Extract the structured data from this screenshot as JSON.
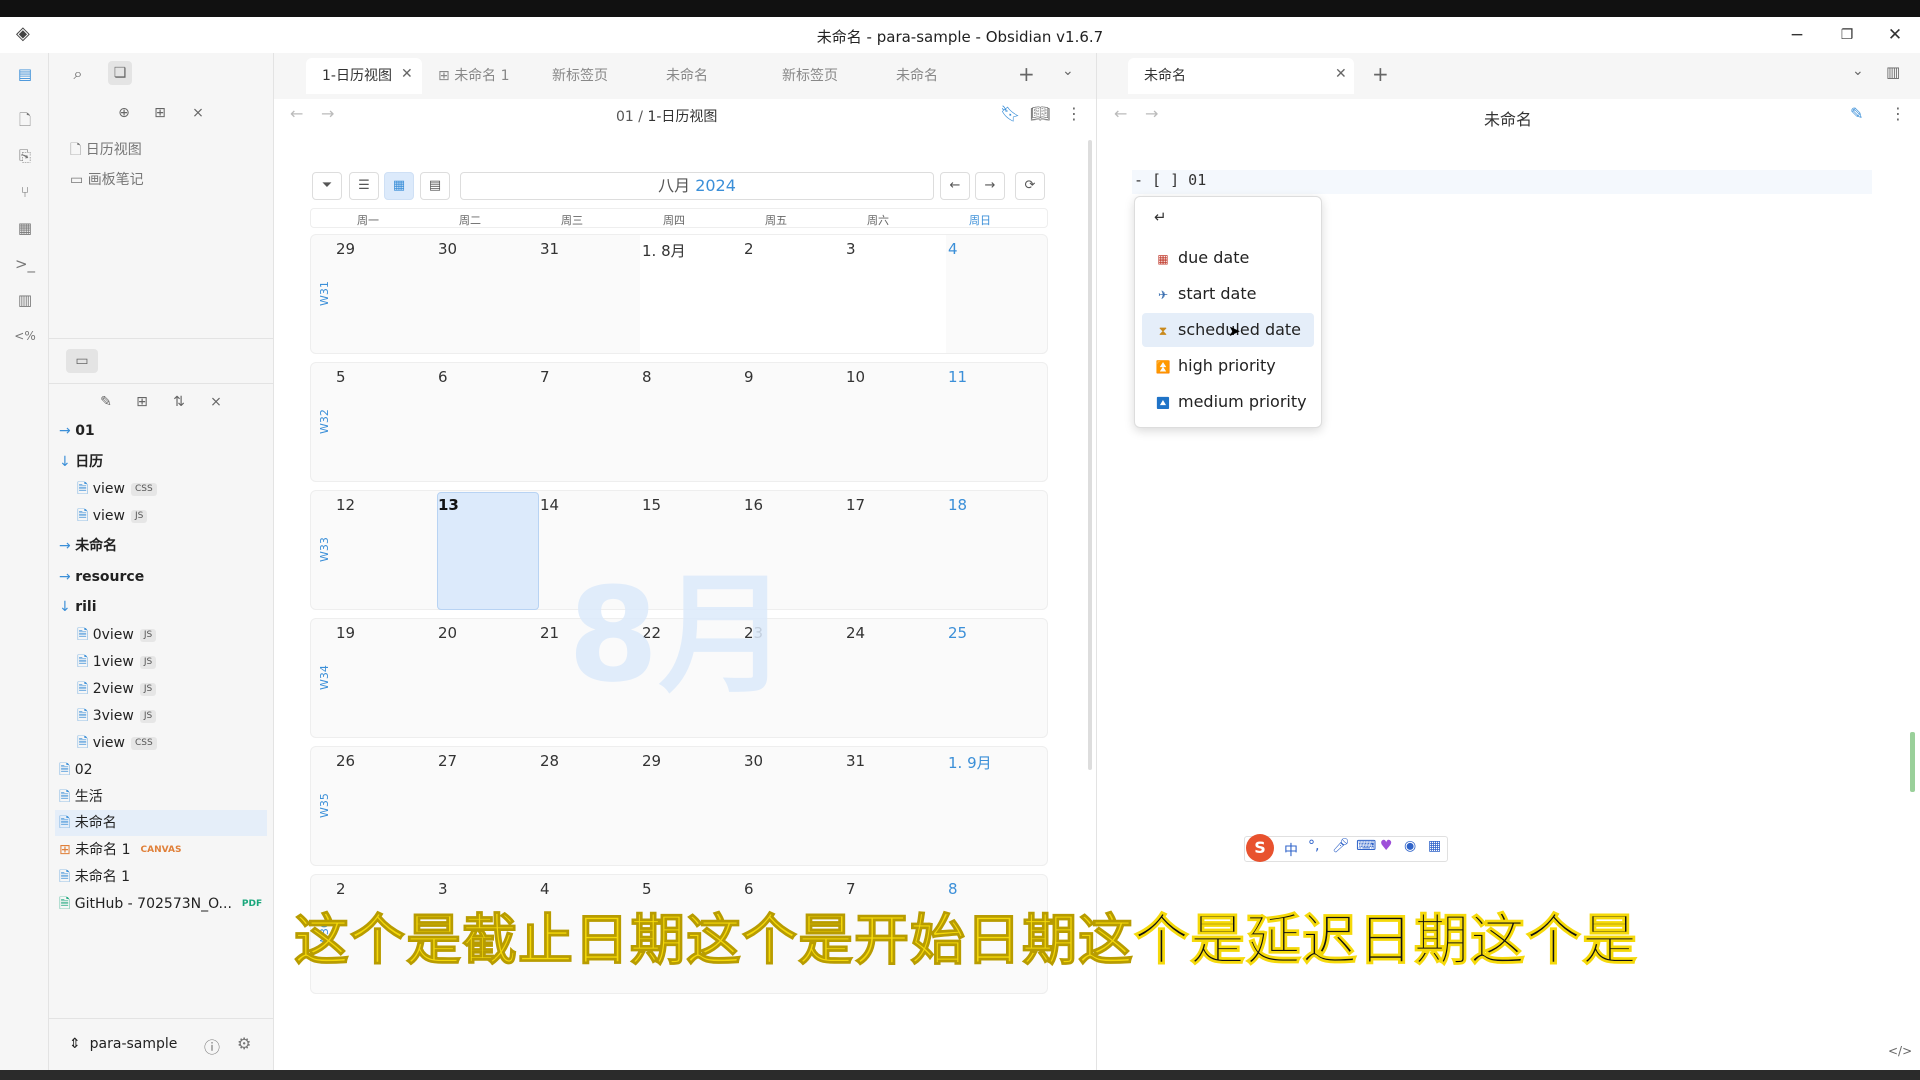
{
  "window": {
    "title": "未命名 - para-sample - Obsidian v1.6.7"
  },
  "left_tree": {
    "bookmarks": [
      "日历视图",
      "画板笔记"
    ],
    "items": [
      {
        "label": "01",
        "type": "folder-collapsed"
      },
      {
        "label": "日历",
        "type": "folder-open"
      },
      {
        "label": "view",
        "tag": "CSS",
        "indent": 1
      },
      {
        "label": "view",
        "tag": "JS",
        "indent": 1
      },
      {
        "label": "未命名",
        "type": "folder-collapsed"
      },
      {
        "label": "resource",
        "type": "folder-collapsed"
      },
      {
        "label": "rili",
        "type": "folder-open"
      },
      {
        "label": "0view",
        "tag": "JS",
        "indent": 1
      },
      {
        "label": "1view",
        "tag": "JS",
        "indent": 1
      },
      {
        "label": "2view",
        "tag": "JS",
        "indent": 1
      },
      {
        "label": "3view",
        "tag": "JS",
        "indent": 1
      },
      {
        "label": "view",
        "tag": "CSS",
        "indent": 1
      },
      {
        "label": "02",
        "type": "file"
      },
      {
        "label": "生活",
        "type": "file"
      },
      {
        "label": "未命名",
        "type": "file",
        "selected": true
      },
      {
        "label": "未命名 1",
        "tag": "CANVAS",
        "type": "canvas"
      },
      {
        "label": "未命名 1",
        "type": "file"
      },
      {
        "label": "GitHub - 702573N_O...",
        "tag": "PDF",
        "type": "pdf"
      }
    ],
    "vault": "para-sample"
  },
  "tabs_left": [
    "1-日历视图",
    "未命名 1",
    "新标签页",
    "未命名",
    "新标签页",
    "未命名"
  ],
  "tabs_right": [
    "未命名"
  ],
  "left_pane": {
    "breadcrumb_folder": "01",
    "breadcrumb_sep": "/",
    "breadcrumb_file": "1-日历视图"
  },
  "right_pane": {
    "title": "未命名",
    "task_line": "- [ ] 01"
  },
  "calendar": {
    "month_label": "八月",
    "year": "2024",
    "watermark": "8月",
    "weekdays": [
      "周一",
      "周二",
      "周三",
      "周四",
      "周五",
      "周六",
      "周日"
    ],
    "weeks": [
      {
        "label": "W31",
        "days": [
          "29",
          "30",
          "31",
          "1. 8月",
          "2",
          "3",
          "4"
        ]
      },
      {
        "label": "W32",
        "days": [
          "5",
          "6",
          "7",
          "8",
          "9",
          "10",
          "11"
        ]
      },
      {
        "label": "W33",
        "days": [
          "12",
          "13",
          "14",
          "15",
          "16",
          "17",
          "18"
        ]
      },
      {
        "label": "W34",
        "days": [
          "19",
          "20",
          "21",
          "22",
          "23",
          "24",
          "25"
        ]
      },
      {
        "label": "W35",
        "days": [
          "26",
          "27",
          "28",
          "29",
          "30",
          "31",
          "1. 9月"
        ]
      },
      {
        "label": "W36",
        "days": [
          "2",
          "3",
          "4",
          "5",
          "6",
          "7",
          "8"
        ]
      }
    ],
    "today": "13"
  },
  "suggest_menu": {
    "first_item": "↵",
    "items": [
      {
        "label": "due date",
        "icon": "calendar-icon",
        "color": "#c0392b"
      },
      {
        "label": "start date",
        "icon": "airplane-icon",
        "color": "#3a6fb0"
      },
      {
        "label": "scheduled date",
        "icon": "hourglass-icon",
        "color": "#c98a1d",
        "hover": true
      },
      {
        "label": "high priority",
        "icon": "priority-high-icon",
        "color": "#1f73c7"
      },
      {
        "label": "medium priority",
        "icon": "priority-medium-icon",
        "color": "#1f73c7"
      }
    ]
  },
  "ime_toolbar": {
    "lang": "中"
  },
  "subtitle": {
    "yellow": "这个是截止日期这个是开始日期这",
    "black": "个是延迟日期这个是"
  },
  "colors": {
    "accent": "#3b8fd8",
    "subtitle_yellow": "#f5d90a",
    "selection": "#dceafb"
  }
}
